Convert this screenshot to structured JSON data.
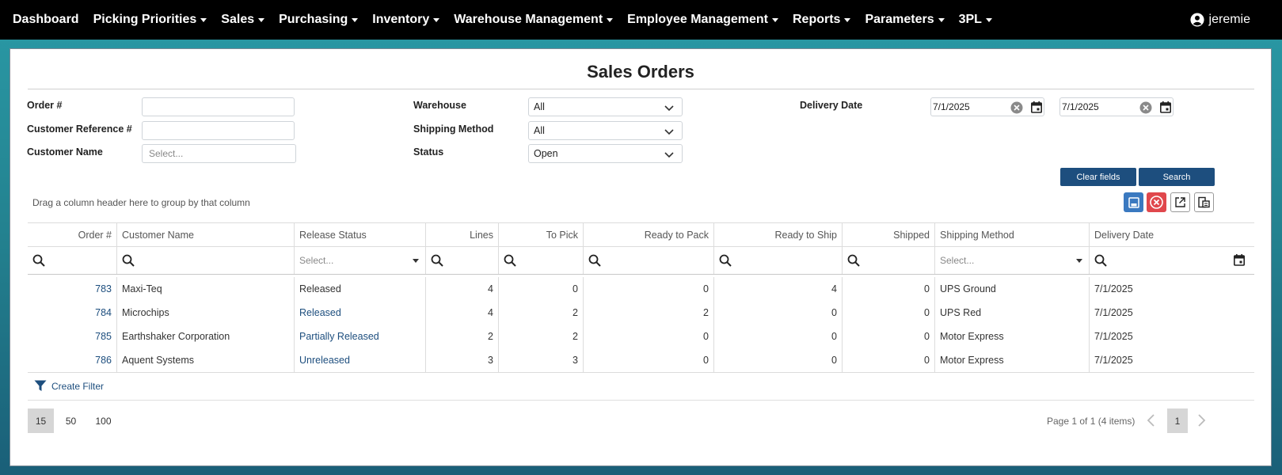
{
  "nav": {
    "items": [
      {
        "label": "Dashboard",
        "dropdown": false
      },
      {
        "label": "Picking Priorities",
        "dropdown": true
      },
      {
        "label": "Sales",
        "dropdown": true
      },
      {
        "label": "Purchasing",
        "dropdown": true
      },
      {
        "label": "Inventory",
        "dropdown": true
      },
      {
        "label": "Warehouse Management",
        "dropdown": true
      },
      {
        "label": "Employee Management",
        "dropdown": true
      },
      {
        "label": "Reports",
        "dropdown": true
      },
      {
        "label": "Parameters",
        "dropdown": true
      },
      {
        "label": "3PL",
        "dropdown": true
      }
    ],
    "user": "jeremie"
  },
  "page": {
    "title": "Sales Orders"
  },
  "filters": {
    "order_label": "Order #",
    "order_value": "",
    "customer_ref_label": "Customer Reference #",
    "customer_ref_value": "",
    "customer_name_label": "Customer Name",
    "customer_name_placeholder": "Select...",
    "warehouse_label": "Warehouse",
    "warehouse_value": "All",
    "shipping_method_label": "Shipping Method",
    "shipping_method_value": "All",
    "status_label": "Status",
    "status_value": "Open",
    "delivery_date_label": "Delivery Date",
    "delivery_date_from": "7/1/2025",
    "delivery_date_to": "7/1/2025",
    "clear_label": "Clear fields",
    "search_label": "Search"
  },
  "grid": {
    "group_hint": "Drag a column header here to group by that column",
    "columns": [
      "Order #",
      "Customer Name",
      "Release Status",
      "Lines",
      "To Pick",
      "Ready to Pack",
      "Ready to Ship",
      "Shipped",
      "Shipping Method",
      "Delivery Date"
    ],
    "filter_select_placeholder": "Select...",
    "rows": [
      {
        "order": "783",
        "customer": "Maxi-Teq",
        "release": "Released",
        "release_link": false,
        "lines": "4",
        "to_pick": "0",
        "ready_pack": "0",
        "ready_ship": "4",
        "shipped": "0",
        "method": "UPS Ground",
        "date": "7/1/2025"
      },
      {
        "order": "784",
        "customer": "Microchips",
        "release": "Released",
        "release_link": true,
        "lines": "4",
        "to_pick": "2",
        "ready_pack": "2",
        "ready_ship": "0",
        "shipped": "0",
        "method": "UPS Red",
        "date": "7/1/2025"
      },
      {
        "order": "785",
        "customer": "Earthshaker Corporation",
        "release": "Partially Released",
        "release_link": true,
        "lines": "2",
        "to_pick": "2",
        "ready_pack": "0",
        "ready_ship": "0",
        "shipped": "0",
        "method": "Motor Express",
        "date": "7/1/2025"
      },
      {
        "order": "786",
        "customer": "Aquent Systems",
        "release": "Unreleased",
        "release_link": true,
        "lines": "3",
        "to_pick": "3",
        "ready_pack": "0",
        "ready_ship": "0",
        "shipped": "0",
        "method": "Motor Express",
        "date": "7/1/2025"
      }
    ],
    "create_filter": "Create Filter"
  },
  "pager": {
    "sizes": [
      "15",
      "50",
      "100"
    ],
    "active_size": "15",
    "info": "Page 1 of 1 (4 items)",
    "current_page": "1"
  },
  "icons": {
    "user": "user-circle-icon",
    "save": "save-icon",
    "cancel": "cancel-icon",
    "export": "export-icon",
    "columns": "column-chooser-icon"
  },
  "colors": {
    "accent": "#1d4e7e",
    "cancel": "#e0474c",
    "save": "#3a79c0"
  }
}
